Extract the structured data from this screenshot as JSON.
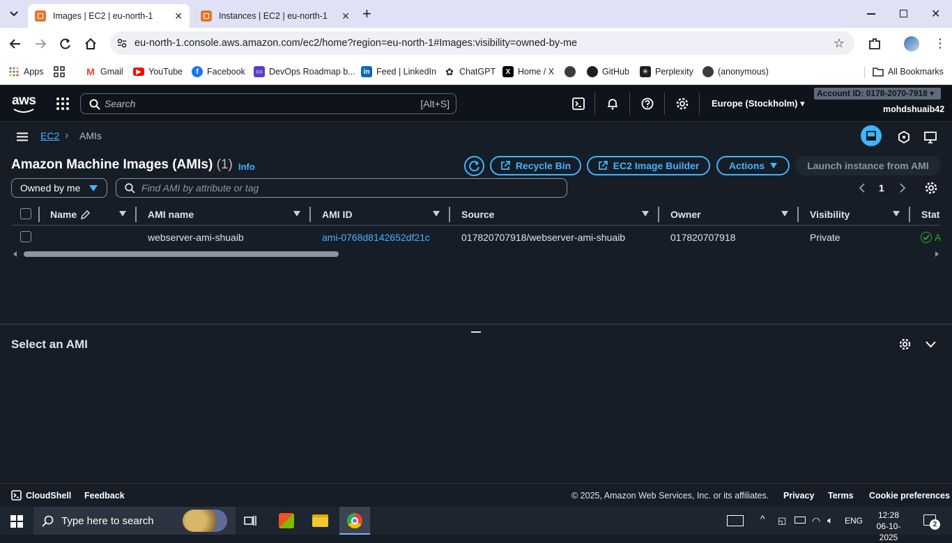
{
  "browser": {
    "tabs": [
      {
        "title": "Images | EC2 | eu-north-1",
        "active": true
      },
      {
        "title": "Instances | EC2 | eu-north-1",
        "active": false
      }
    ],
    "url": "eu-north-1.console.aws.amazon.com/ec2/home?region=eu-north-1#Images:visibility=owned-by-me",
    "bookmarks": [
      "Apps",
      "Gmail",
      "YouTube",
      "Facebook",
      "DevOps Roadmap b...",
      "Feed | LinkedIn",
      "ChatGPT",
      "Home / X",
      "GitHub",
      "Perplexity",
      "(anonymous)"
    ],
    "all_bookmarks": "All Bookmarks"
  },
  "aws": {
    "logo": "aws",
    "search_placeholder": "Search",
    "search_shortcut": "[Alt+S]",
    "region": "Europe (Stockholm)",
    "account_id": "Account ID: 0178-2070-7918",
    "username": "mohdshuaib42"
  },
  "breadcrumb": {
    "root": "EC2",
    "current": "AMIs"
  },
  "page": {
    "title": "Amazon Machine Images (AMIs)",
    "count": "(1)",
    "info": "Info",
    "buttons": {
      "recycle_bin": "Recycle Bin",
      "image_builder": "EC2 Image Builder",
      "actions": "Actions",
      "launch": "Launch instance from AMI"
    },
    "filter_select": "Owned by me",
    "filter_placeholder": "Find AMI by attribute or tag",
    "page_number": "1"
  },
  "table": {
    "headers": [
      "Name",
      "AMI name",
      "AMI ID",
      "Source",
      "Owner",
      "Visibility",
      "Stat"
    ],
    "rows": [
      {
        "name": "",
        "ami_name": "webserver-ami-shuaib",
        "ami_id": "ami-0768d8142652df21c",
        "source": "017820707918/webserver-ami-shuaib",
        "owner": "017820707918",
        "visibility": "Private"
      }
    ]
  },
  "detail_panel": {
    "title": "Select an AMI"
  },
  "footer": {
    "cloudshell": "CloudShell",
    "feedback": "Feedback",
    "copyright": "© 2025, Amazon Web Services, Inc. or its affiliates.",
    "privacy": "Privacy",
    "terms": "Terms",
    "cookies": "Cookie preferences"
  },
  "taskbar": {
    "search_placeholder": "Type here to search",
    "language": "ENG",
    "time": "12:28",
    "date": "06-10-2025",
    "notifications": "2"
  },
  "colors": {
    "link": "#42b4ff",
    "background": "#161d26",
    "nav": "#0f141a",
    "success": "#29ad32"
  }
}
